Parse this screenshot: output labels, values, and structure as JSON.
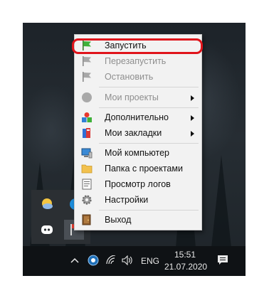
{
  "menu": {
    "items": [
      {
        "label": "Запустить",
        "icon": "green-flag-icon"
      },
      {
        "label": "Перезапустить",
        "icon": "gray-flag-icon"
      },
      {
        "label": "Остановить",
        "icon": "gray-flag-icon"
      },
      {
        "label": "Мои проекты",
        "icon": "gray-circle-icon"
      },
      {
        "label": "Дополнительно",
        "icon": "colored-shapes-icon"
      },
      {
        "label": "Мои закладки",
        "icon": "books-icon"
      },
      {
        "label": "Мой компьютер",
        "icon": "computer-icon"
      },
      {
        "label": "Папка с проектами",
        "icon": "folder-icon"
      },
      {
        "label": "Просмотр логов",
        "icon": "log-icon"
      },
      {
        "label": "Настройки",
        "icon": "gear-icon"
      },
      {
        "label": "Выход",
        "icon": "exit-door-icon"
      }
    ],
    "highlight_color": "#e0141b"
  },
  "tray_popup": {
    "icons": [
      "weather-icon",
      "edge-icon",
      "discord-icon",
      "openserver-flag-icon"
    ]
  },
  "taskbar": {
    "language": "ENG",
    "time": "15:51",
    "date": "21.07.2020",
    "icons": [
      "chevron-up-icon",
      "defender-icon",
      "wifi-icon",
      "volume-icon",
      "notification-icon"
    ]
  }
}
